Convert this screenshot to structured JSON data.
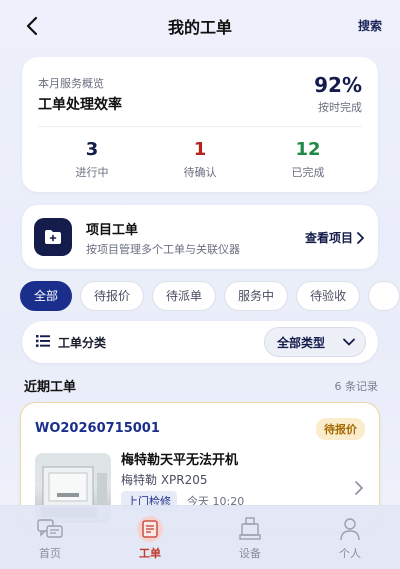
{
  "header": {
    "title": "我的工单",
    "search_label": "搜索",
    "back_icon": "chevron-left-icon"
  },
  "summary": {
    "subtitle": "本月服务概览",
    "title": "工单处理效率",
    "rate": "92%",
    "rate_label": "按时完成",
    "stats": [
      {
        "value": "3",
        "label": "进行中",
        "color": "#141c4c"
      },
      {
        "value": "1",
        "label": "待确认",
        "color": "#b3241f"
      },
      {
        "value": "12",
        "label": "已完成",
        "color": "#1e8a46"
      }
    ]
  },
  "project": {
    "icon": "folder-plus-icon",
    "title": "项目工单",
    "desc": "按项目管理多个工单与关联仪器",
    "link": "查看项目"
  },
  "tabs": [
    {
      "label": "全部",
      "active": true
    },
    {
      "label": "待报价"
    },
    {
      "label": "待派单"
    },
    {
      "label": "服务中"
    },
    {
      "label": "待验收"
    }
  ],
  "filter": {
    "label": "工单分类",
    "selected": "全部类型",
    "icon": "list-icon"
  },
  "recent": {
    "title": "近期工单",
    "count": "6 条记录",
    "orders": [
      {
        "id": "WO20260715001",
        "status": "待报价",
        "title": "梅特勒天平无法开机",
        "model": "梅特勒 XPR205",
        "type": "上门检修",
        "time": "今天 10:20",
        "status_color": "#a46a00"
      }
    ]
  },
  "nav": [
    {
      "label": "首页",
      "icon": "chat-icon"
    },
    {
      "label": "工单",
      "icon": "work-order-icon",
      "active": true
    },
    {
      "label": "设备",
      "icon": "device-icon"
    },
    {
      "label": "个人",
      "icon": "person-icon"
    }
  ]
}
